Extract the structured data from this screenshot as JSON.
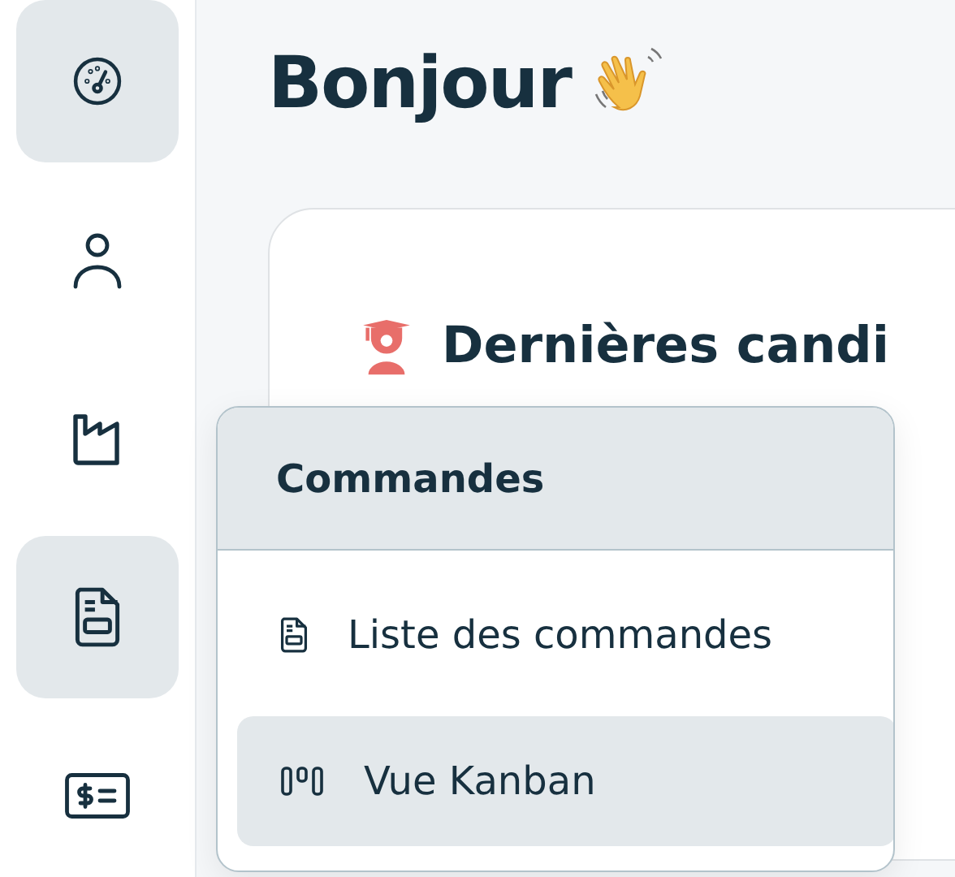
{
  "sidebar": {
    "items": [
      {
        "selected": true
      },
      {
        "selected": false
      },
      {
        "selected": false
      },
      {
        "selected": true
      },
      {
        "selected": false
      }
    ]
  },
  "greeting": {
    "title": "Bonjour"
  },
  "card": {
    "title": "Dernières candi"
  },
  "menu": {
    "title": "Commandes",
    "items": [
      {
        "label": "Liste des commandes",
        "selected": false
      },
      {
        "label": "Vue Kanban",
        "selected": true
      }
    ]
  }
}
